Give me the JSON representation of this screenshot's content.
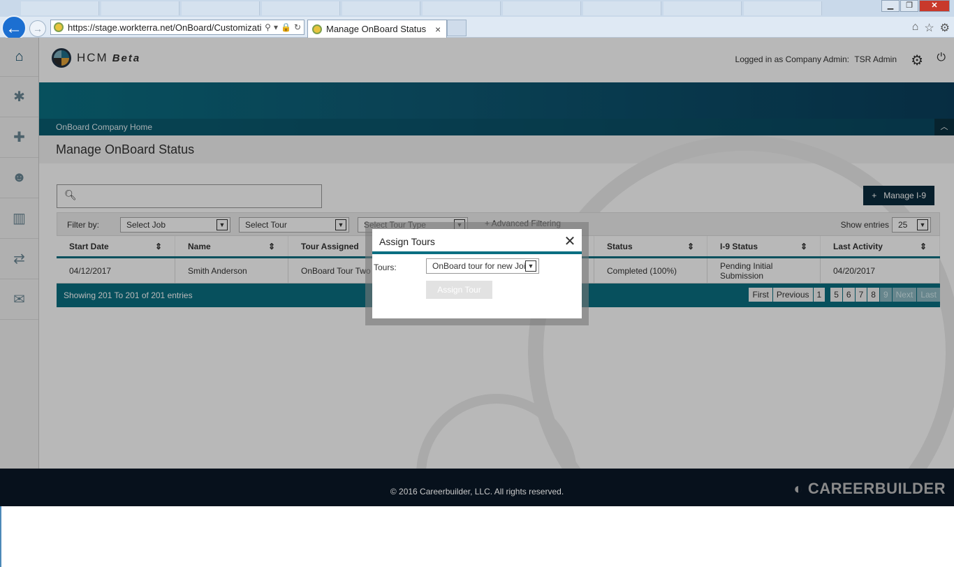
{
  "browser": {
    "url": "https://stage.workterra.net/OnBoard/Customizatio",
    "tab_title": "Manage OnBoard Status",
    "tab_close": "×",
    "back_icon": "back-arrow-icon",
    "forward_icon": "forward-arrow-icon"
  },
  "header": {
    "brand": "HCM",
    "beta": "Beta",
    "logged_in_label": "Logged in as Company Admin:",
    "user_name": "TSR Admin"
  },
  "sidebar": {
    "items": [
      {
        "icon": "home-icon",
        "glyph": "⌂"
      },
      {
        "icon": "puzzle-icon",
        "glyph": "✱"
      },
      {
        "icon": "add-user-icon",
        "glyph": "👤"
      },
      {
        "icon": "user-icon",
        "glyph": "👤"
      },
      {
        "icon": "bar-chart-icon",
        "glyph": "▮"
      },
      {
        "icon": "transfer-icon",
        "glyph": "⇄"
      },
      {
        "icon": "chat-icon",
        "glyph": "💬"
      }
    ]
  },
  "breadcrumb": "OnBoard Company Home",
  "page_title": "Manage OnBoard Status",
  "toolbar": {
    "manage_i9": "Manage I-9",
    "manage_i9_plus": "+"
  },
  "filters": {
    "label": "Filter by:",
    "job": "Select Job",
    "tour": "Select Tour",
    "tour_type": "Select Tour Type",
    "advanced": "+ Advanced Filtering",
    "show_entries": "Show entries",
    "entries_value": "25"
  },
  "table": {
    "columns": [
      "Start Date",
      "Name",
      "Tour Assigned",
      "",
      "Status",
      "I-9 Status",
      "Last Activity"
    ],
    "row": [
      "04/12/2017",
      "Smith Anderson",
      "OnBoard Tour Two",
      "",
      "Completed (100%)",
      "Pending Initial Submission",
      "04/20/2017"
    ],
    "showing": "Showing 201 To 201 of 201 entries"
  },
  "pager": {
    "first": "First",
    "previous": "Previous",
    "p1": "1",
    "p5": "5",
    "p6": "6",
    "p7": "7",
    "p8": "8",
    "p9": "9",
    "next": "Next",
    "last": "Last"
  },
  "modal": {
    "title": "Assign Tours",
    "close": "✕",
    "tours_label": "Tours:",
    "tours_value": "OnBoard tour for new Joir",
    "assign_button": "Assign Tour"
  },
  "footer": {
    "copyright": "© 2016 Careerbuilder, LLC. All rights reserved.",
    "logo": "CAREERBUILDER"
  }
}
